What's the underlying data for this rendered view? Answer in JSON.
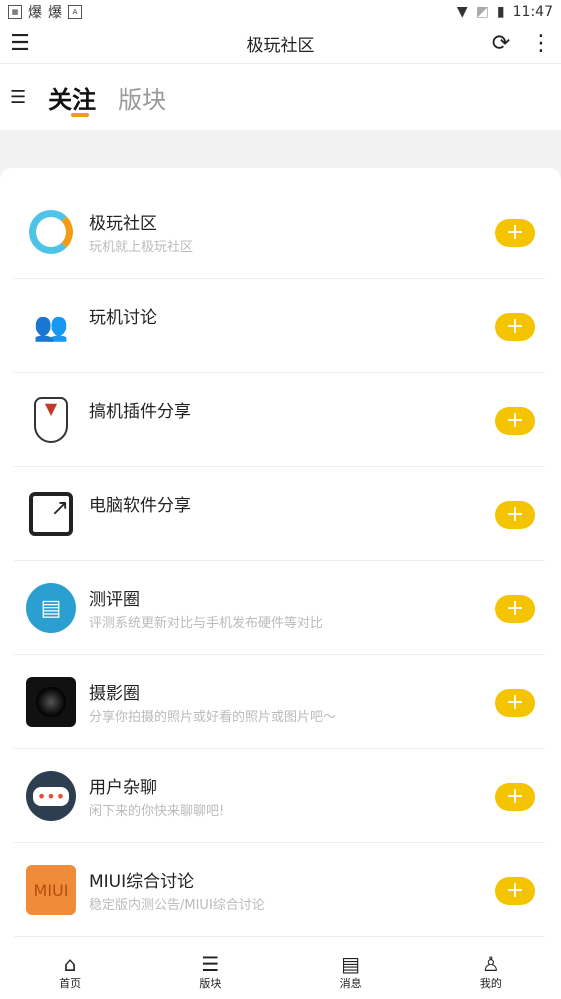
{
  "status": {
    "time": "11:47",
    "notif": [
      "爆",
      "爆"
    ]
  },
  "appbar": {
    "title": "极玩社区"
  },
  "tabs": [
    {
      "label": "关注",
      "active": true
    },
    {
      "label": "版块",
      "active": false
    }
  ],
  "accent": "#f39c12",
  "plus_color": "#f5c400",
  "forums": [
    {
      "name": "极玩社区",
      "desc": "玩机就上极玩社区",
      "icon": "g-logo-icon"
    },
    {
      "name": "玩机讨论",
      "desc": "",
      "icon": "people-icon"
    },
    {
      "name": "搞机插件分享",
      "desc": "",
      "icon": "mask-icon"
    },
    {
      "name": "电脑软件分享",
      "desc": "",
      "icon": "share-icon"
    },
    {
      "name": "测评圈",
      "desc": "评测系统更新对比与手机发布硬件等对比",
      "icon": "document-icon"
    },
    {
      "name": "摄影圈",
      "desc": "分享你拍摄的照片或好看的照片或图片吧～",
      "icon": "camera-lens-icon"
    },
    {
      "name": "用户杂聊",
      "desc": "闲下来的你快来聊聊吧!",
      "icon": "chat-icon"
    },
    {
      "name": "MIUI综合讨论",
      "desc": "稳定版内测公告/MIUI综合讨论",
      "icon": "miui-icon"
    }
  ],
  "plus": "+",
  "nav": [
    {
      "label": "首页",
      "icon": "home-icon"
    },
    {
      "label": "版块",
      "icon": "list-icon"
    },
    {
      "label": "消息",
      "icon": "clipboard-icon"
    },
    {
      "label": "我的",
      "icon": "user-icon"
    }
  ]
}
